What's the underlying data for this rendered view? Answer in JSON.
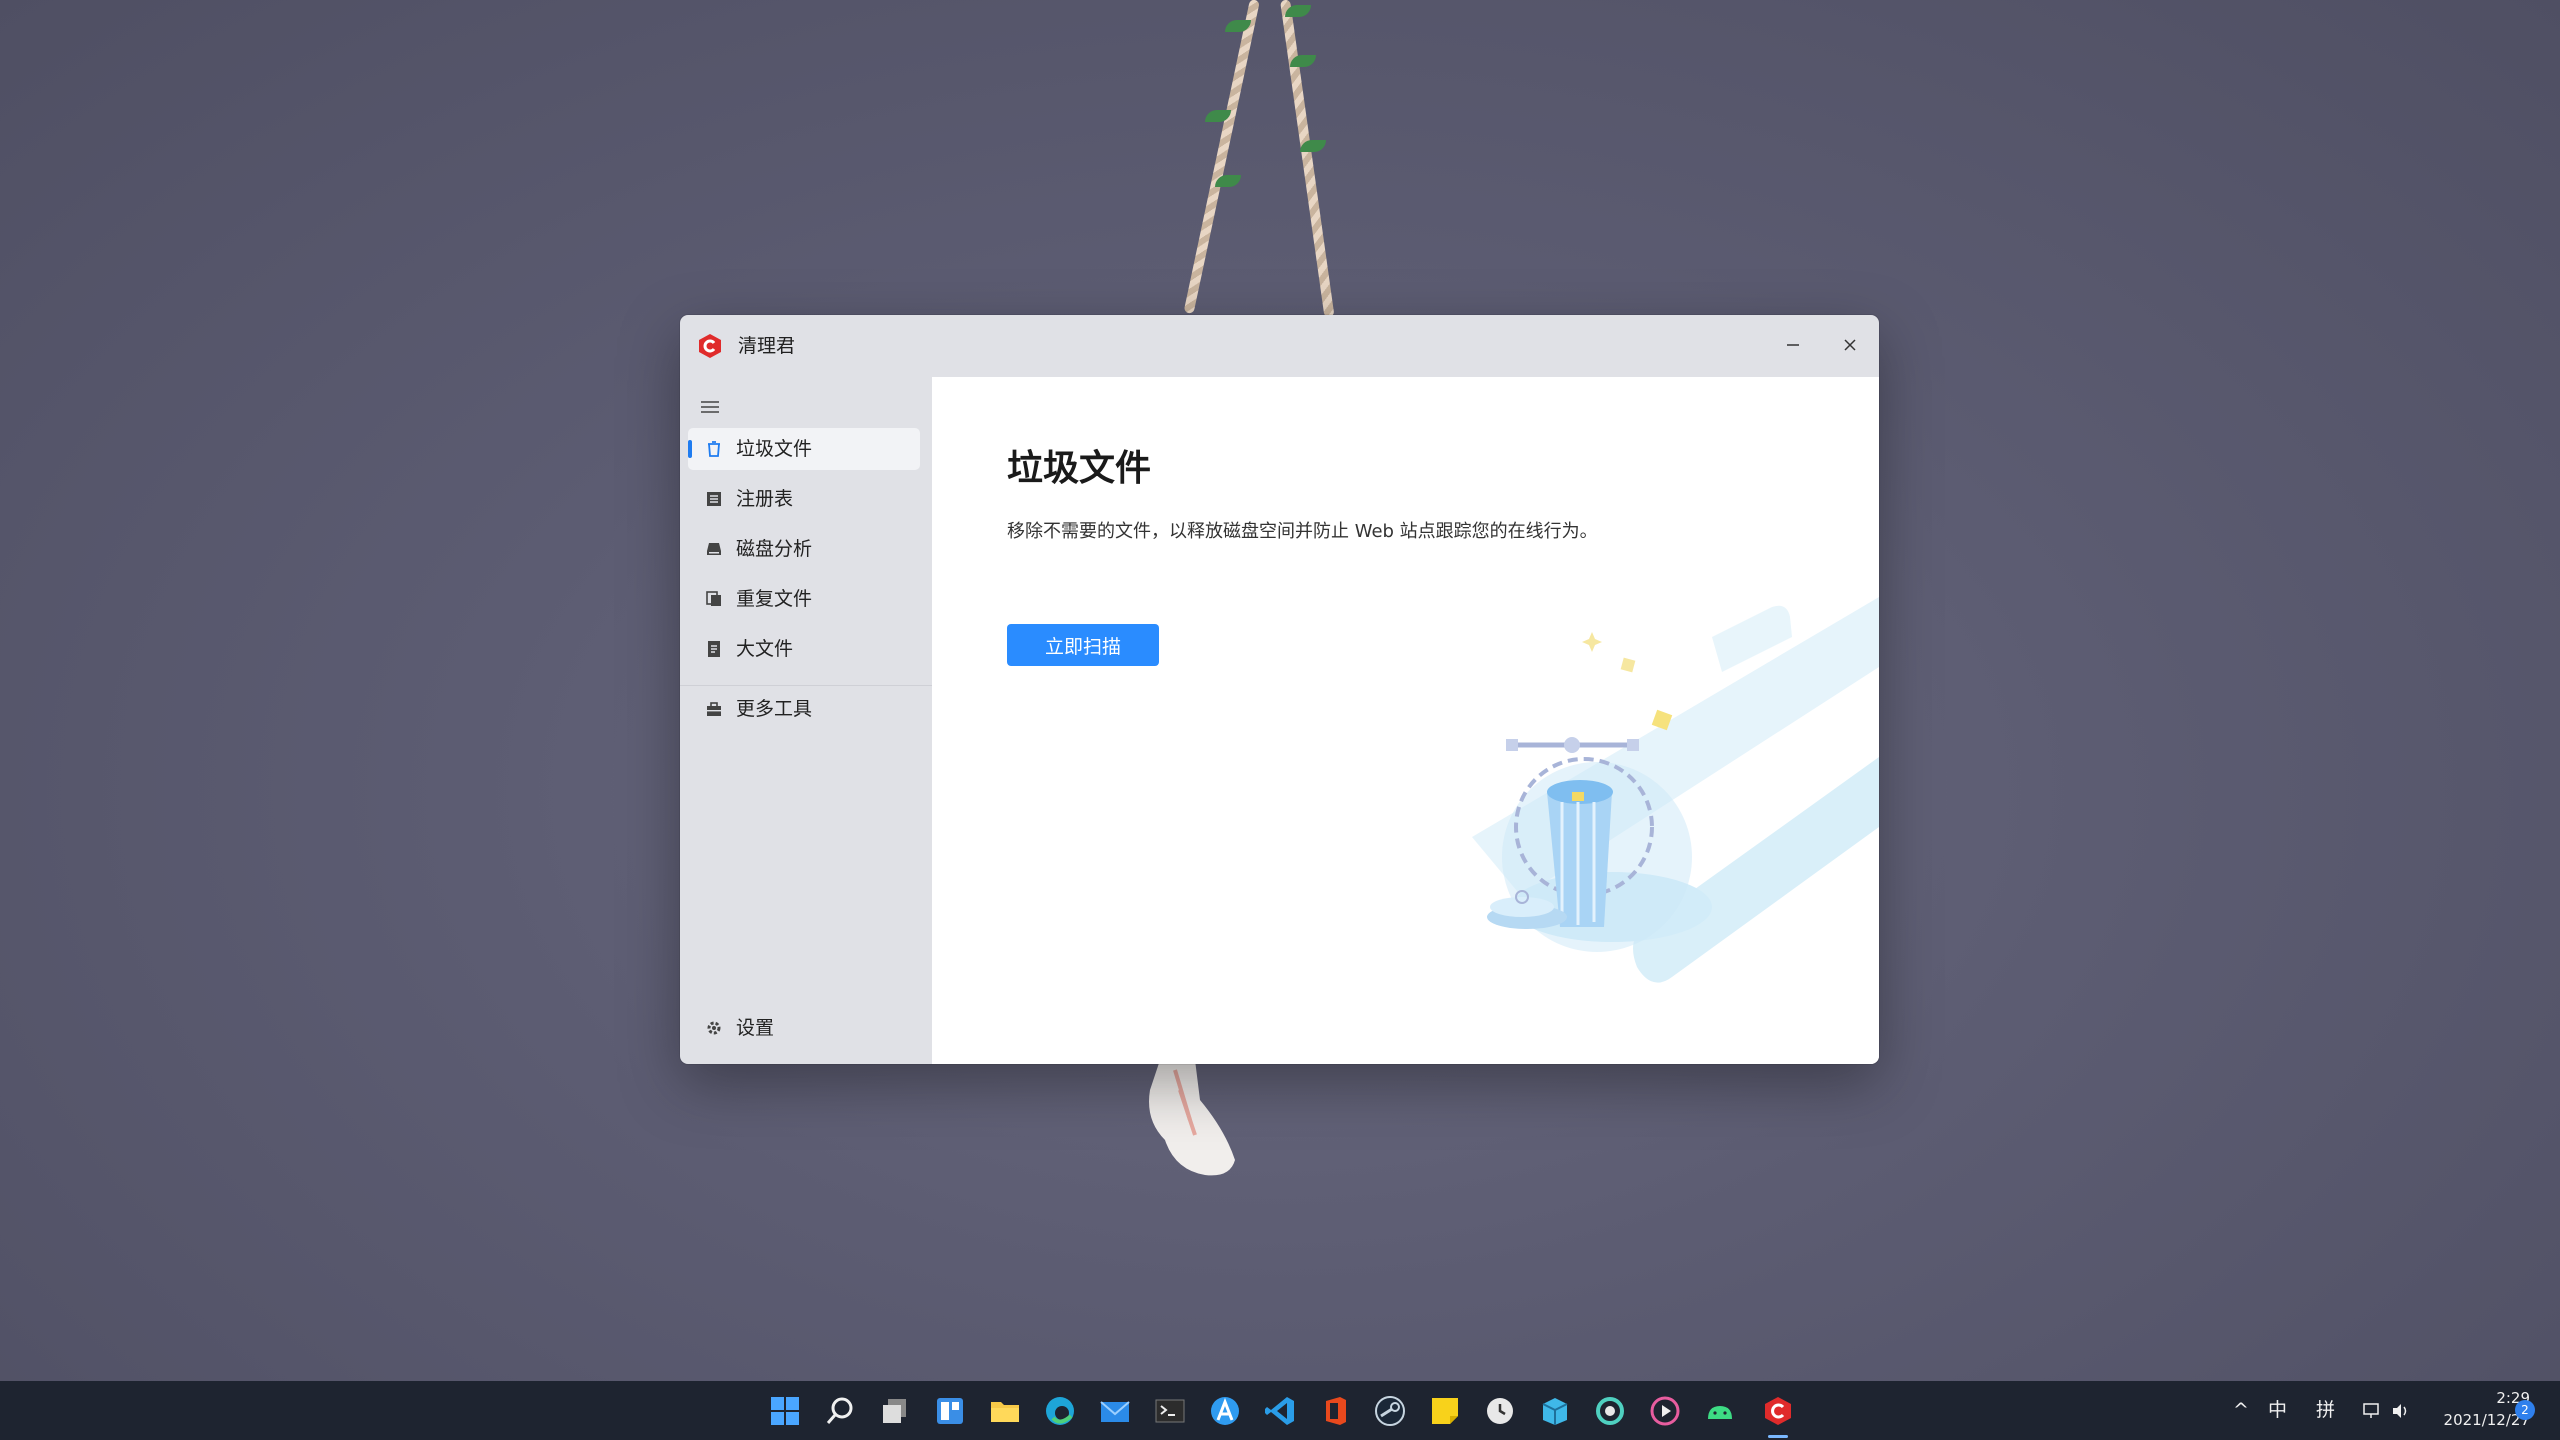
{
  "window": {
    "app_title": "清理君",
    "minimize_icon": "minimize-icon",
    "close_icon": "close-icon"
  },
  "sidebar": {
    "menu_icon": "hamburger-menu-icon",
    "items": [
      {
        "label": "垃圾文件",
        "icon": "trash-icon",
        "active": true
      },
      {
        "label": "注册表",
        "icon": "registry-icon",
        "active": false
      },
      {
        "label": "磁盘分析",
        "icon": "disk-icon",
        "active": false
      },
      {
        "label": "重复文件",
        "icon": "duplicate-files-icon",
        "active": false
      },
      {
        "label": "大文件",
        "icon": "large-file-icon",
        "active": false
      },
      {
        "label": "更多工具",
        "icon": "toolbox-icon",
        "active": false
      }
    ],
    "settings_label": "设置"
  },
  "main": {
    "title": "垃圾文件",
    "description": "移除不需要的文件，以释放磁盘空间并防止 Web 站点跟踪您的在线行为。",
    "scan_button": "立即扫描"
  },
  "taskbar": {
    "icons": [
      "start-icon",
      "search-icon",
      "task-view-icon",
      "widgets-icon",
      "file-explorer-icon",
      "edge-icon",
      "mail-icon",
      "terminal-icon",
      "app-a-icon",
      "vscode-icon",
      "office-icon",
      "steam-icon",
      "sticky-notes-icon",
      "clock-app-icon",
      "package-icon",
      "ring-app-icon",
      "media-player-icon",
      "android-icon",
      "cleaner-app-icon"
    ],
    "tray": {
      "chevron": "^",
      "lang": "中",
      "ime": "拼",
      "time": "2:29",
      "date": "2021/12/27",
      "notifications": "2"
    }
  },
  "colors": {
    "accent": "#2a8cff",
    "indicator": "#1f7cf0",
    "brand_red": "#e02b2b",
    "sidebar_bg": "#e0e1e6",
    "taskbar_bg": "#1e2430"
  }
}
